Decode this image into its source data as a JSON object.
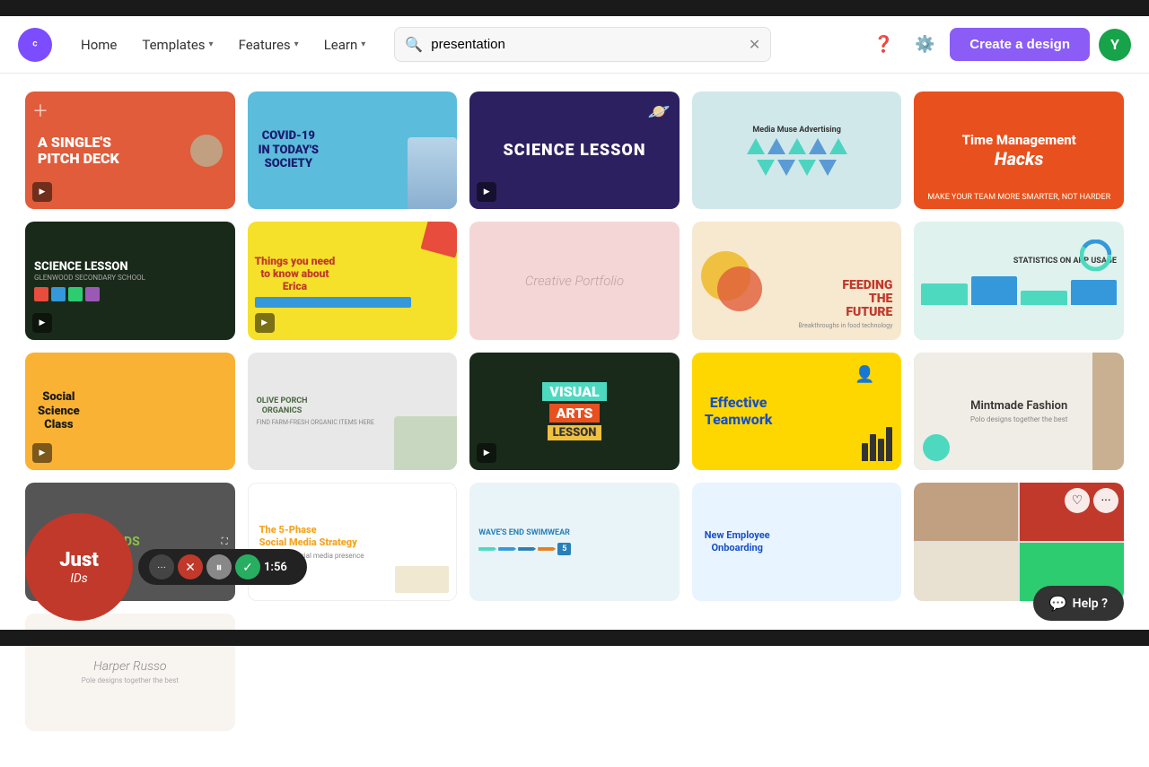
{
  "topBar": {},
  "header": {
    "logo": "Canva",
    "nav": {
      "home": "Home",
      "templates": "Templates",
      "features": "Features",
      "learn": "Learn"
    },
    "search": {
      "placeholder": "presentation",
      "value": "presentation"
    },
    "createBtn": "Create a design",
    "avatarInitial": "Y"
  },
  "cards": [
    {
      "id": "card-1",
      "title": "A Single's Pitch Deck",
      "bg": "#e05c3a",
      "hasPlay": true
    },
    {
      "id": "card-2",
      "title": "COVID-19 IN TODAY'S SOCIETY",
      "bg": "#5bbcdb",
      "hasPlay": false
    },
    {
      "id": "card-3",
      "title": "SCIENCE LESSON",
      "bg": "#2d2060",
      "hasPlay": true
    },
    {
      "id": "card-4",
      "title": "Media Muse Advertising",
      "bg": "#d1e8ea",
      "hasPlay": false
    },
    {
      "id": "card-5",
      "title": "Time Management Hacks",
      "bg": "#e8501e",
      "hasPlay": false
    },
    {
      "id": "card-6",
      "title": "SCIENCE LESSON",
      "bg": "#1a2a1a",
      "hasPlay": true
    },
    {
      "id": "card-7",
      "title": "Things you need to know about Erica",
      "bg": "#f5e02a",
      "hasPlay": true
    },
    {
      "id": "card-8",
      "title": "Creative Portfolio",
      "bg": "#f5d6d6",
      "hasPlay": false
    },
    {
      "id": "card-9",
      "title": "FEEDING THE FUTURE",
      "bg": "#f7e8d0",
      "hasPlay": false
    },
    {
      "id": "card-10",
      "title": "Statistics on App Usage",
      "bg": "#dff2ee",
      "hasPlay": false
    },
    {
      "id": "card-11",
      "title": "Social Science Class",
      "bg": "#f9b234",
      "hasPlay": true
    },
    {
      "id": "card-12",
      "title": "Olive Porch Organics",
      "bg": "#e8e8e8",
      "hasPlay": false
    },
    {
      "id": "card-13",
      "title": "VISUAL ARTS LESSON",
      "bg": "#1a2a1a",
      "hasPlay": true
    },
    {
      "id": "card-14",
      "title": "Effective Teamwork",
      "bg": "#ffd700",
      "hasPlay": false
    },
    {
      "id": "card-15",
      "title": "Mintmade Fashion",
      "bg": "#f5f0e8",
      "hasPlay": false
    },
    {
      "id": "card-16",
      "title": "Just IDs",
      "bg": "#333",
      "hasPlay": false
    },
    {
      "id": "card-17",
      "title": "The 5-Phase Social Media Strategy",
      "sub": "Build your social media presence",
      "bg": "#fff",
      "hasPlay": false
    },
    {
      "id": "card-18",
      "title": "Wave's End Swimwear",
      "bg": "#4dd9c0",
      "hasPlay": false
    },
    {
      "id": "card-19",
      "title": "New Employee Onboarding",
      "bg": "#e8f4ff",
      "hasPlay": false
    },
    {
      "id": "card-20",
      "title": "Photo collage",
      "bg": "#e0e0e0",
      "hasPlay": false
    },
    {
      "id": "card-21",
      "title": "Harper Russo",
      "bg": "#f8f4f0",
      "hasPlay": false
    }
  ],
  "recording": {
    "title": "Just",
    "subtitle": "IDs",
    "time": "1:56"
  },
  "help": {
    "label": "Help ?"
  }
}
